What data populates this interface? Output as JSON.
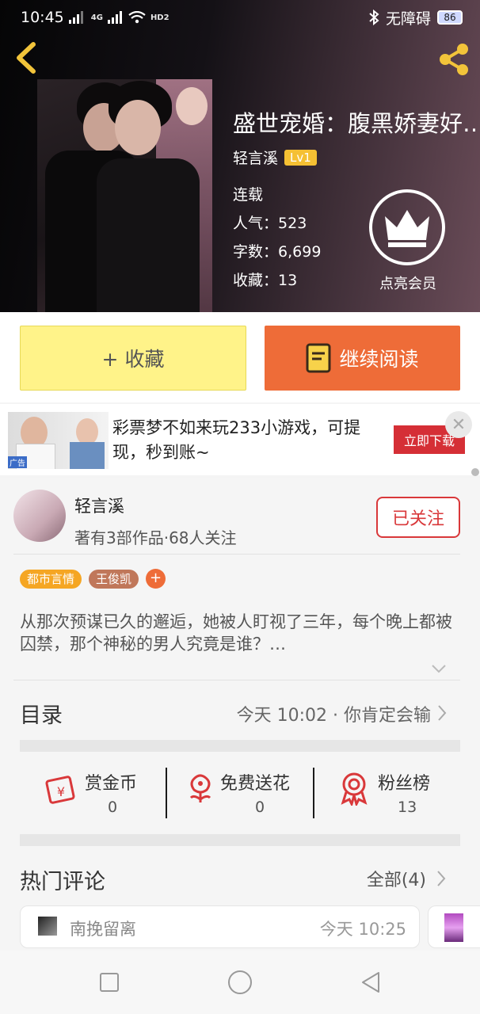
{
  "status_bar": {
    "time": "10:45",
    "signal_label": "4G",
    "hd_label": "HD2",
    "accessibility": "无障碍",
    "battery": "86"
  },
  "book": {
    "title": "盛世宠婚：腹黑娇妻好…",
    "author": "轻言溪",
    "level": "Lv1",
    "status": "连载",
    "popularity_label": "人气：",
    "popularity": "523",
    "words_label": "字数：",
    "words": "6,699",
    "favorites_label": "收藏：",
    "favorites": "13",
    "vip_label": "点亮会员"
  },
  "actions": {
    "collect_label": "+ 收藏",
    "read_label": "继续阅读"
  },
  "ad": {
    "text": "彩票梦不如来玩233小游戏，可提现，秒到账~",
    "cta": "立即下载",
    "close_glyph": "✕",
    "thumb_tag": "广告"
  },
  "author_card": {
    "name": "轻言溪",
    "info": "著有3部作品·68人关注",
    "follow_label": "已关注"
  },
  "tags": [
    {
      "label": "都市言情",
      "color": "#f5a623"
    },
    {
      "label": "王俊凯",
      "color": "#c0775a"
    }
  ],
  "tag_add": "+",
  "summary": "从那次预谋已久的邂逅，她被人盯视了三年，每个晚上都被囚禁，那个神秘的男人究竟是谁？…",
  "toc": {
    "title": "目录",
    "latest": "今天 10:02 · 你肯定会输"
  },
  "stats": [
    {
      "label": "赏金币",
      "count": "0",
      "icon": "coin-envelope-icon"
    },
    {
      "label": "免费送花",
      "count": "0",
      "icon": "flower-icon"
    },
    {
      "label": "粉丝榜",
      "count": "13",
      "icon": "medal-icon"
    }
  ],
  "comments": {
    "title": "热门评论",
    "all_label": "全部(4)",
    "first": {
      "user": "南挽留离",
      "time": "今天 10:25"
    }
  },
  "colors": {
    "accent_orange": "#ee6c38",
    "collect_yellow": "#fff389",
    "follow_red": "#d9383a",
    "ad_red": "#d52f36"
  }
}
